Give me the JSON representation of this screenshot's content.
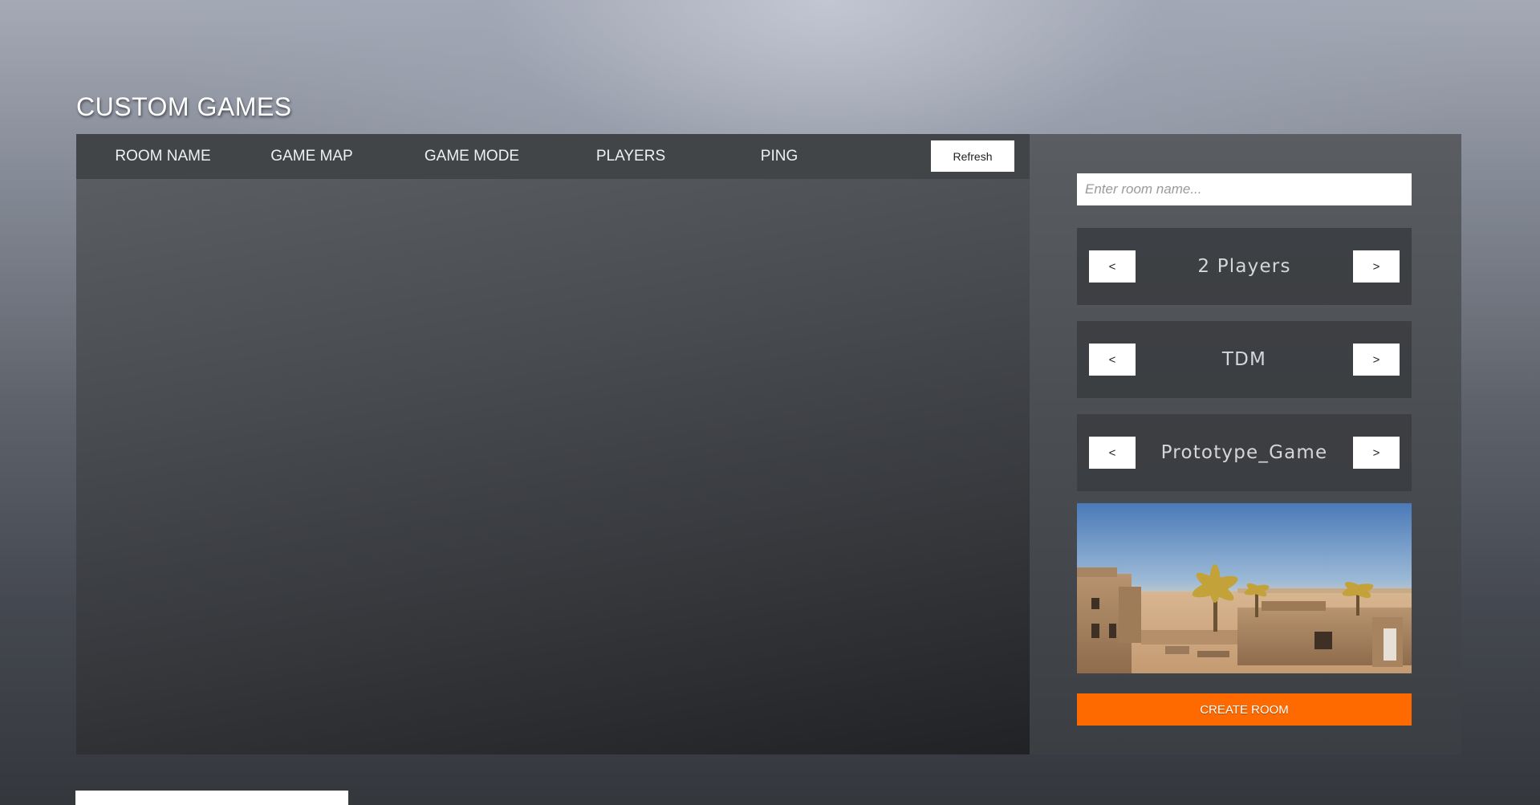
{
  "page": {
    "title": "CUSTOM GAMES"
  },
  "room_list": {
    "columns": [
      "ROOM NAME",
      "GAME MAP",
      "GAME MODE",
      "PLAYERS",
      "PING"
    ],
    "refresh_label": "Refresh",
    "rooms": []
  },
  "create_panel": {
    "room_name": {
      "value": "",
      "placeholder": "Enter room name..."
    },
    "players_selector": {
      "value": "2 Players",
      "prev_label": "<",
      "next_label": ">"
    },
    "mode_selector": {
      "value": "TDM",
      "prev_label": "<",
      "next_label": ">"
    },
    "map_selector": {
      "value": "Prototype_Game",
      "prev_label": "<",
      "next_label": ">"
    },
    "create_label": "CREATE ROOM"
  },
  "colors": {
    "accent": "#ff6a00",
    "panel_dark": "#424548",
    "button_bg": "#ffffff"
  },
  "icons": {
    "map_preview": "desert-map-thumbnail"
  }
}
